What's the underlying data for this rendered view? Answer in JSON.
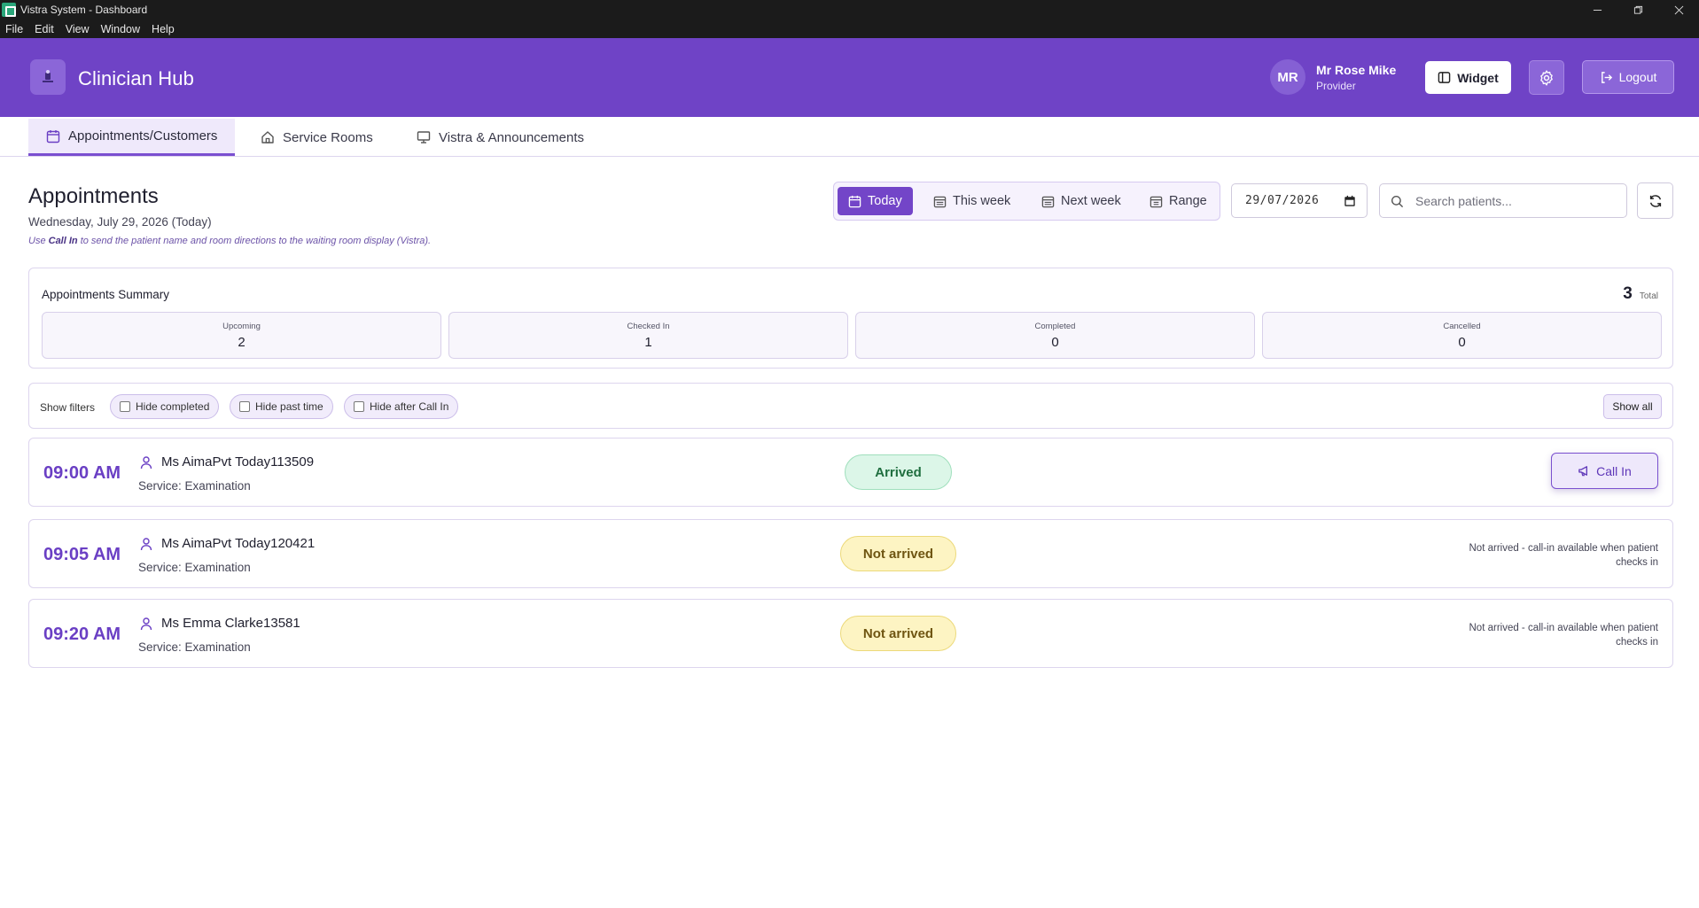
{
  "window": {
    "title": "Vistra System - Dashboard",
    "menu": [
      "File",
      "Edit",
      "View",
      "Window",
      "Help"
    ]
  },
  "header": {
    "brand": "Clinician Hub",
    "user": {
      "initials": "MR",
      "name": "Mr Rose Mike",
      "role": "Provider"
    },
    "widget_label": "Widget",
    "logout_label": "Logout",
    "color": "#6f43c6"
  },
  "tabs": [
    {
      "label": "Appointments/Customers",
      "active": true,
      "icon": "calendar-icon"
    },
    {
      "label": "Service Rooms",
      "active": false,
      "icon": "home-icon"
    },
    {
      "label": "Vistra & Announcements",
      "active": false,
      "icon": "monitor-icon"
    }
  ],
  "page": {
    "title": "Appointments",
    "date": "Wednesday, July 29, 2026 (Today)",
    "hint_prefix": "Use ",
    "hint_strong": "Call In",
    "hint_suffix": " to send the patient name and room directions to the waiting room display (Vistra)."
  },
  "range": {
    "buttons": [
      {
        "label": "Today",
        "active": true
      },
      {
        "label": "This week",
        "active": false
      },
      {
        "label": "Next week",
        "active": false
      },
      {
        "label": "Range",
        "active": false
      }
    ],
    "date_value": "29/07/2026",
    "search_placeholder": "Search patients..."
  },
  "summary": {
    "title": "Appointments Summary",
    "total": "3",
    "total_label": "Total",
    "stats": [
      {
        "label": "Upcoming",
        "value": "2"
      },
      {
        "label": "Checked In",
        "value": "1"
      },
      {
        "label": "Completed",
        "value": "0"
      },
      {
        "label": "Cancelled",
        "value": "0"
      }
    ]
  },
  "filters": {
    "label": "Show filters",
    "chips": [
      {
        "label": "Hide completed",
        "checked": false
      },
      {
        "label": "Hide past time",
        "checked": false
      },
      {
        "label": "Hide after Call In",
        "checked": false
      }
    ],
    "show_all": "Show all"
  },
  "appointments": [
    {
      "time": "09:00 AM",
      "name": "Ms AimaPvt Today113509",
      "service": "Service: Examination",
      "status": "Arrived",
      "action": "Call In"
    },
    {
      "time": "09:05 AM",
      "name": "Ms AimaPvt Today120421",
      "service": "Service: Examination",
      "status": "Not arrived",
      "note": "Not arrived - call-in available when patient checks in"
    },
    {
      "time": "09:20 AM",
      "name": "Ms Emma Clarke13581",
      "service": "Service: Examination",
      "status": "Not arrived",
      "note": "Not arrived - call-in available when patient checks in"
    }
  ]
}
